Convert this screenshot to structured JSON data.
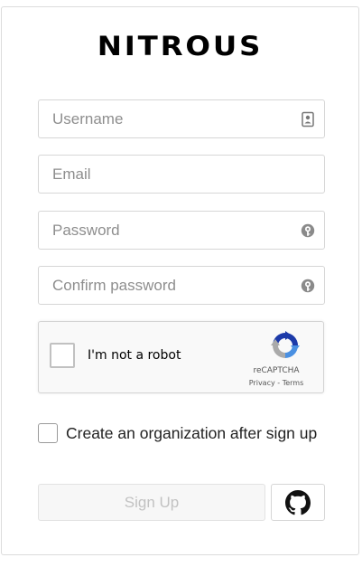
{
  "brand": {
    "logo_text": "NITROUS"
  },
  "form": {
    "username": {
      "placeholder": "Username",
      "value": "",
      "icon": "contact-card-icon"
    },
    "email": {
      "placeholder": "Email",
      "value": ""
    },
    "password": {
      "placeholder": "Password",
      "value": "",
      "icon": "password-key-icon"
    },
    "confirm_password": {
      "placeholder": "Confirm password",
      "value": "",
      "icon": "password-key-icon"
    }
  },
  "recaptcha": {
    "checkbox_label": "I'm not a robot",
    "brand": "reCAPTCHA",
    "links": "Privacy - Terms",
    "checked": false
  },
  "organization": {
    "label": "Create an organization after sign up",
    "checked": false
  },
  "actions": {
    "signup_label": "Sign Up",
    "signup_disabled": true,
    "github_icon": "github-icon"
  }
}
